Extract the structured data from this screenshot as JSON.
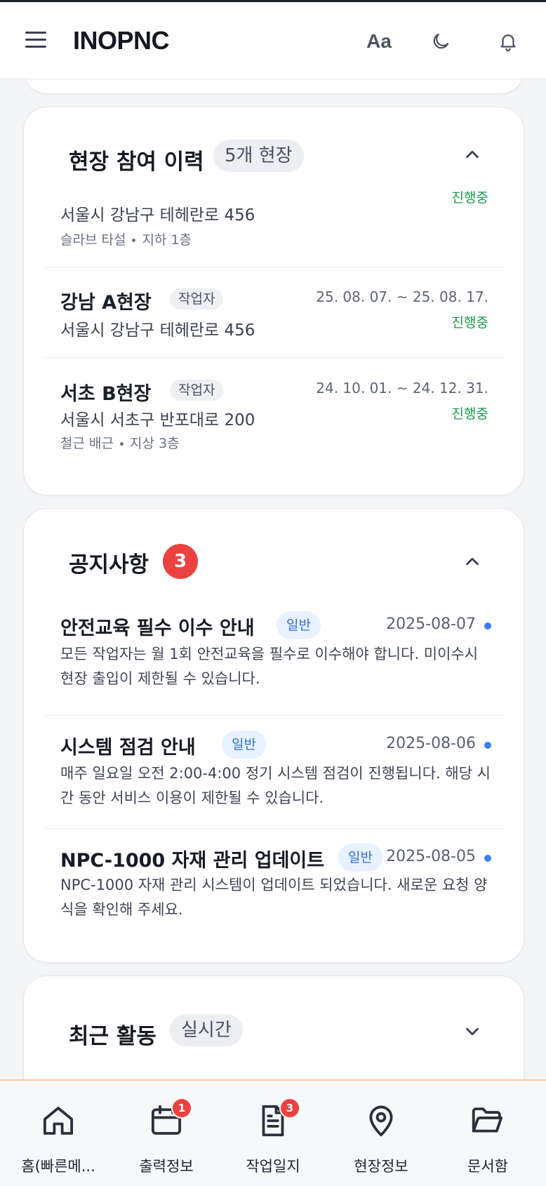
{
  "header": {
    "brand": "INOPNC",
    "font_toggle": "Aa"
  },
  "sites_card": {
    "title": "현장 참여 이력",
    "count_pill": "5개 현장",
    "partial_row": {
      "address": "서울시 강남구 테헤란로 456",
      "detail_a": "슬라브 타설",
      "detail_b": "지하 1층",
      "status": "진행중"
    },
    "rows": [
      {
        "name": "강남 A현장",
        "role": "작업자",
        "address": "서울시 강남구 테헤란로 456",
        "period": "25. 08. 07. ~ 25. 08. 17.",
        "status": "진행중"
      },
      {
        "name": "서초 B현장",
        "role": "작업자",
        "address": "서울시 서초구 반포대로 200",
        "period": "24. 10. 01. ~ 24. 12. 31.",
        "status": "진행중",
        "detail_a": "철근 배근",
        "detail_b": "지상 3층"
      }
    ]
  },
  "notice_card": {
    "title": "공지사항",
    "badge": "3",
    "items": [
      {
        "title": "안전교육 필수 이수 안내",
        "tag": "일반",
        "date": "2025-08-07",
        "body": "모든 작업자는 월 1회 안전교육을 필수로 이수해야 합니다. 미이수시 현장 출입이 제한될 수 있습니다."
      },
      {
        "title": "시스템 점검 안내",
        "tag": "일반",
        "date": "2025-08-06",
        "body": "매주 일요일 오전 2:00-4:00 정기 시스템 점검이 진행됩니다. 해당 시간 동안 서비스 이용이 제한될 수 있습니다."
      },
      {
        "title": "NPC-1000 자재 관리 업데이트",
        "tag": "일반",
        "date": "2025-08-05",
        "body": "NPC-1000 자재 관리 시스템이 업데이트 되었습니다. 새로운 요청 양식을 확인해 주세요."
      }
    ]
  },
  "activity_card": {
    "title": "최근 활동",
    "pill": "실시간"
  },
  "bottom_nav": [
    {
      "label": "홈(빠른메...",
      "icon": "home-icon"
    },
    {
      "label": "출력정보",
      "icon": "calendar-icon",
      "badge": "1"
    },
    {
      "label": "작업일지",
      "icon": "document-icon",
      "badge": "3"
    },
    {
      "label": "현장정보",
      "icon": "map-pin-icon"
    },
    {
      "label": "문서함",
      "icon": "folder-icon"
    }
  ],
  "colors": {
    "accent_blue": "#3b7ff0",
    "status_green": "#1a9b48",
    "badge_red": "#ec4141"
  }
}
